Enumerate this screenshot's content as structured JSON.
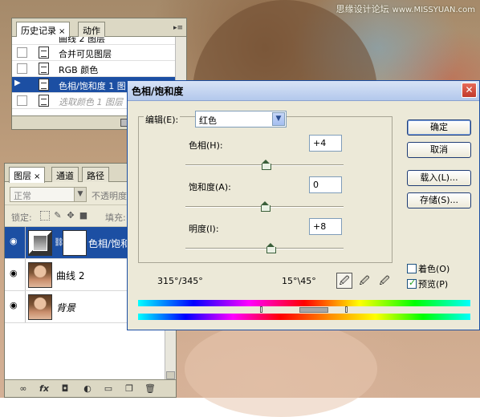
{
  "watermark": {
    "cn": "思缘设计论坛",
    "en": "www.MISSYUAN.com"
  },
  "history_panel": {
    "tabs": [
      {
        "label": "历史记录",
        "active": true,
        "close": "×"
      },
      {
        "label": "动作",
        "active": false
      }
    ],
    "items": [
      {
        "label": "曲线 2 图层",
        "state": "partial"
      },
      {
        "label": "合并可见图层",
        "state": "normal"
      },
      {
        "label": "RGB 颜色",
        "state": "normal"
      },
      {
        "label": "色相/饱和度 1 图",
        "state": "selected"
      },
      {
        "label": "选取颜色 1 图层",
        "state": "dimmed"
      }
    ]
  },
  "layers_panel": {
    "tabs": [
      {
        "label": "图层",
        "active": true,
        "close": "×"
      },
      {
        "label": "通道",
        "active": false
      },
      {
        "label": "路径",
        "active": false
      }
    ],
    "blend_mode": "正常",
    "opacity_label": "不透明度:",
    "lock_label": "锁定:",
    "fill_label": "填充:",
    "layers": [
      {
        "name": "色相/饱和",
        "type": "adjustment",
        "selected": true
      },
      {
        "name": "曲线 2",
        "type": "photo",
        "selected": false
      },
      {
        "name": "背景",
        "type": "photo",
        "selected": false,
        "italic": true
      }
    ],
    "footer_icons": [
      "link-icon",
      "fx-icon",
      "mask-icon",
      "adjustment-icon",
      "folder-icon",
      "new-layer-icon",
      "trash-icon"
    ]
  },
  "dialog": {
    "title": "色相/饱和度",
    "edit_label": "编辑(E):",
    "edit_value": "红色",
    "hue": {
      "label": "色相(H):",
      "value": "+4",
      "level": 0.51
    },
    "saturation": {
      "label": "饱和度(A):",
      "value": "0",
      "level": 0.5
    },
    "lightness": {
      "label": "明度(I):",
      "value": "+8",
      "level": 0.54
    },
    "buttons": {
      "ok": "确定",
      "cancel": "取消",
      "load": "载入(L)...",
      "save": "存储(S)..."
    },
    "colorize": {
      "label": "着色(O)",
      "checked": false
    },
    "preview": {
      "label": "预览(P)",
      "checked": true
    },
    "range_left": "315°/345°",
    "range_right": "15°\\45°"
  }
}
